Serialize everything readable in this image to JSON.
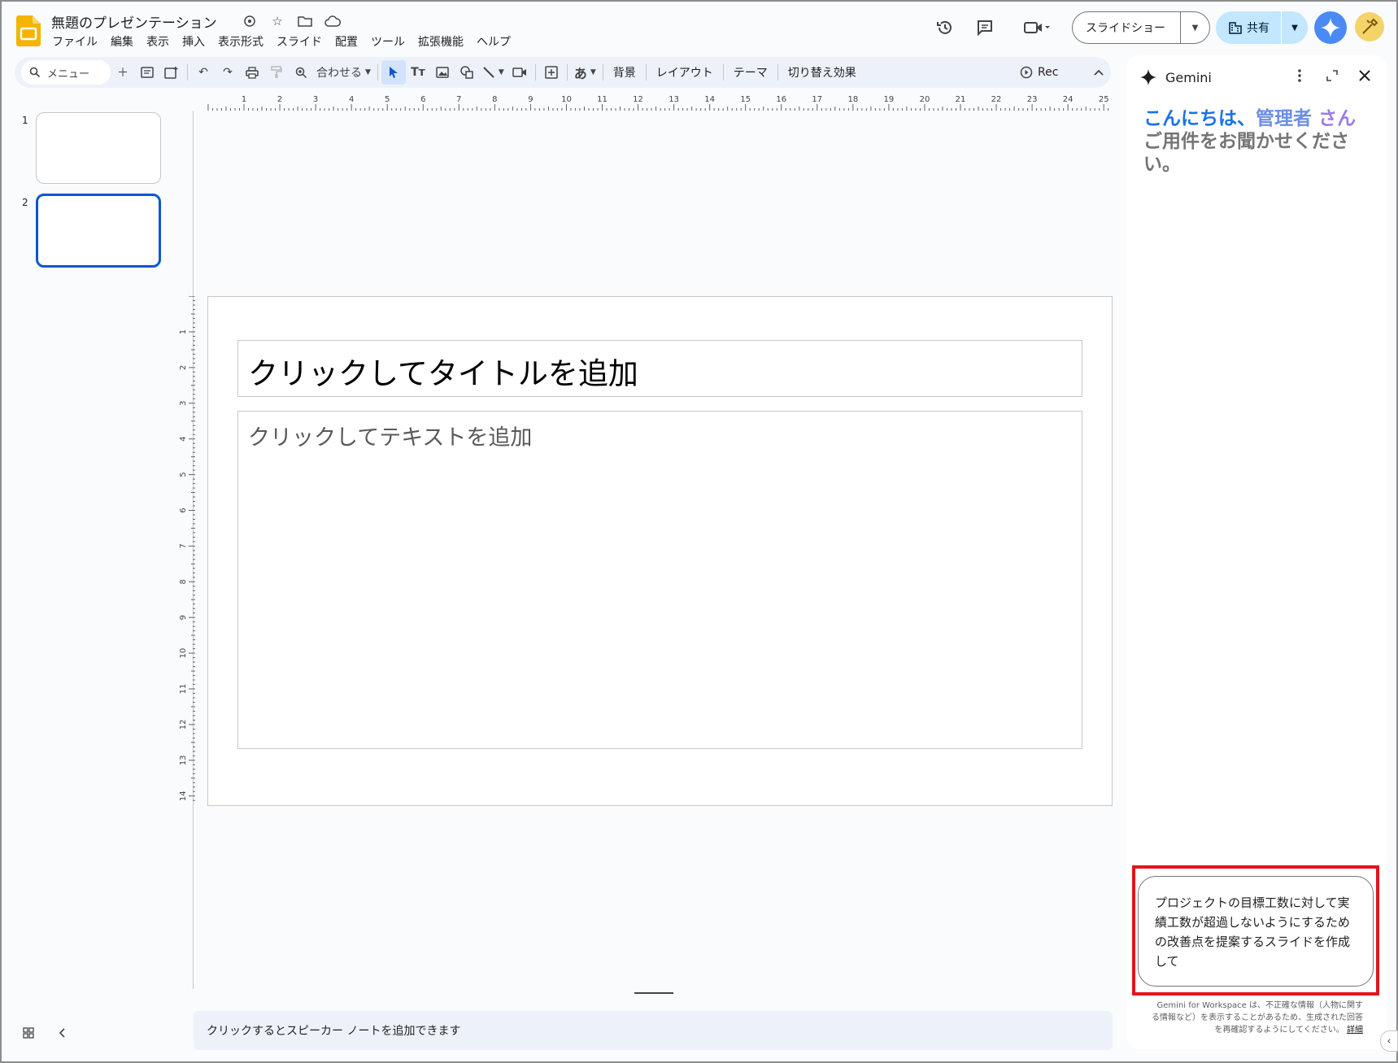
{
  "document": {
    "title": "無題のプレゼンテーション"
  },
  "menu": [
    "ファイル",
    "編集",
    "表示",
    "挿入",
    "表示形式",
    "スライド",
    "配置",
    "ツール",
    "拡張機能",
    "ヘルプ"
  ],
  "header": {
    "slideshow_label": "スライドショー",
    "share_label": "共有"
  },
  "toolbar": {
    "search_label": "メニュー",
    "zoom_label": "合わせる",
    "text_buttons": [
      "背景",
      "レイアウト",
      "テーマ",
      "切り替え効果"
    ],
    "ime_label": "あ",
    "rec_label": "Rec"
  },
  "filmstrip": {
    "slides": [
      "1",
      "2"
    ],
    "selected": "2"
  },
  "rulers": {
    "horizontal_ticks": [
      "1",
      "2",
      "3",
      "4",
      "5",
      "6",
      "7",
      "8",
      "9",
      "10",
      "11",
      "12",
      "13",
      "14",
      "15",
      "16",
      "17",
      "18",
      "19",
      "20",
      "21",
      "22",
      "23",
      "24",
      "25"
    ],
    "vertical_ticks": [
      "1",
      "2",
      "3",
      "4",
      "5",
      "6",
      "7",
      "8",
      "9",
      "10",
      "11",
      "12",
      "13",
      "14"
    ]
  },
  "slide": {
    "title_placeholder": "クリックしてタイトルを追加",
    "body_placeholder": "クリックしてテキストを追加"
  },
  "notes": {
    "placeholder": "クリックするとスピーカー ノートを追加できます"
  },
  "gemini": {
    "title": "Gemini",
    "greeting_hello": "こんにちは、",
    "greeting_name": "管理者",
    "greeting_san": " さん",
    "greeting_ask": "ご用件をお聞かせください。",
    "input_text": "プロジェクトの目標工数に対して実績工数が超過しないようにするための改善点を提案するスライドを作成して",
    "disclaimer": "Gemini for Workspace は、不正確な情報（人物に関する情報など）を表示することがあるため、生成された回答を再確認するようにしてください。",
    "disclaimer_link": "詳細"
  },
  "colors": {
    "accent": "#0b57d0",
    "share_bg": "#c2e7ff",
    "gemini_button": "#4a8af4",
    "highlight_outline": "#e4141b"
  }
}
